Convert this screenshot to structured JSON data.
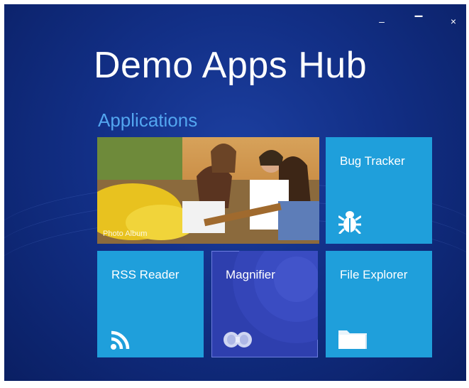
{
  "window": {
    "minimize_glyph": "–",
    "maximize_glyph": "▔",
    "close_glyph": "×"
  },
  "header": {
    "title": "Demo Apps Hub"
  },
  "section": {
    "label": "Applications"
  },
  "tiles": [
    {
      "label": "Photo Album",
      "icon": "photo",
      "color": "#c98a2e"
    },
    {
      "label": "Bug Tracker",
      "icon": "bug-icon",
      "color": "#1f9fdb"
    },
    {
      "label": "RSS Reader",
      "icon": "rss-icon",
      "color": "#1f9fdb"
    },
    {
      "label": "Magnifier",
      "icon": "magnifier-icon",
      "color": "#2e3fae"
    },
    {
      "label": "File Explorer",
      "icon": "folder-icon",
      "color": "#1f9fdb"
    }
  ]
}
